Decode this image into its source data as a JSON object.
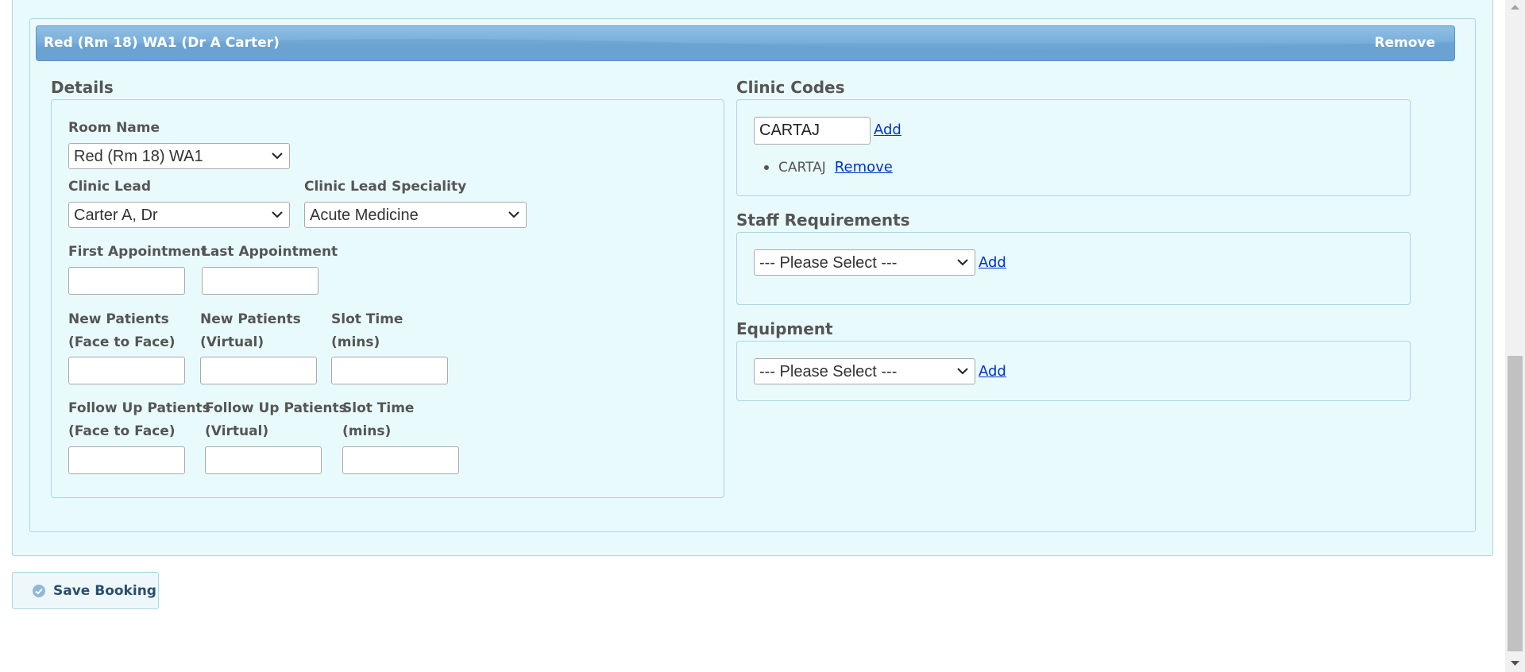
{
  "header": {
    "title": "Red (Rm 18) WA1 (Dr A Carter)",
    "remove_label": "Remove"
  },
  "details": {
    "title": "Details",
    "room_name": {
      "label": "Room Name",
      "value": "Red (Rm 18) WA1"
    },
    "clinic_lead": {
      "label": "Clinic Lead",
      "value": "Carter A, Dr"
    },
    "clinic_lead_speciality": {
      "label": "Clinic Lead Speciality",
      "value": "Acute Medicine"
    },
    "first_appointment": {
      "label": "First Appointment",
      "value": ""
    },
    "last_appointment": {
      "label": "Last Appointment",
      "value": ""
    },
    "new_patients_f2f": {
      "label_1": "New Patients",
      "label_2": "(Face to Face)",
      "value": ""
    },
    "new_patients_virtual": {
      "label_1": "New Patients",
      "label_2": "(Virtual)",
      "value": ""
    },
    "new_slot_time": {
      "label_1": "Slot Time",
      "label_2": "(mins)",
      "value": ""
    },
    "followup_f2f": {
      "label_1": "Follow Up Patients",
      "label_2": "(Face to Face)",
      "value": ""
    },
    "followup_virtual": {
      "label_1": "Follow Up Patients",
      "label_2": "(Virtual)",
      "value": ""
    },
    "followup_slot_time": {
      "label_1": "Slot Time",
      "label_2": "(mins)",
      "value": ""
    }
  },
  "clinic_codes": {
    "title": "Clinic Codes",
    "input_value": "CARTAJ",
    "add_label": "Add",
    "items": [
      {
        "code": "CARTAJ",
        "remove_label": "Remove"
      }
    ]
  },
  "staff_requirements": {
    "title": "Staff Requirements",
    "select_value": "--- Please Select ---",
    "add_label": "Add"
  },
  "equipment": {
    "title": "Equipment",
    "select_value": "--- Please Select ---",
    "add_label": "Add"
  },
  "save_button": {
    "label": "Save Booking",
    "icon": "check-circle-icon"
  },
  "colors": {
    "header_blue": "#78aedb",
    "panel_bg": "#e9fafc",
    "panel_border": "#a8d8e0",
    "link": "#0033cc"
  }
}
